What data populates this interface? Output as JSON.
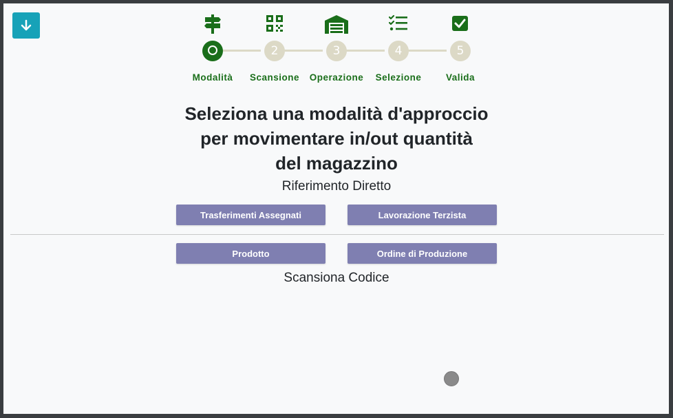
{
  "steps": [
    {
      "label": "Modalità",
      "number": "",
      "icon": "signpost-icon",
      "active": true
    },
    {
      "label": "Scansione",
      "number": "2",
      "icon": "qr-code-icon",
      "active": false
    },
    {
      "label": "Operazione",
      "number": "3",
      "icon": "warehouse-icon",
      "active": false
    },
    {
      "label": "Selezione",
      "number": "4",
      "icon": "checklist-icon",
      "active": false
    },
    {
      "label": "Valida",
      "number": "5",
      "icon": "check-square-icon",
      "active": false
    }
  ],
  "headline": {
    "line1": "Seleziona una modalità d'approccio",
    "line2": "per movimentare in/out quantità",
    "line3": "del magazzino"
  },
  "sections": {
    "direct_reference": "Riferimento Diretto",
    "scan_code": "Scansiona Codice"
  },
  "buttons": {
    "assigned_transfers": "Trasferimenti Assegnati",
    "third_party_processing": "Lavorazione Terzista",
    "product": "Prodotto",
    "production_order": "Ordine di Produzione"
  },
  "colors": {
    "accent_green": "#1a6e1a",
    "inactive_step": "#dcd9c6",
    "mode_button": "#7f7fb1",
    "download_button": "#17a2b8"
  }
}
